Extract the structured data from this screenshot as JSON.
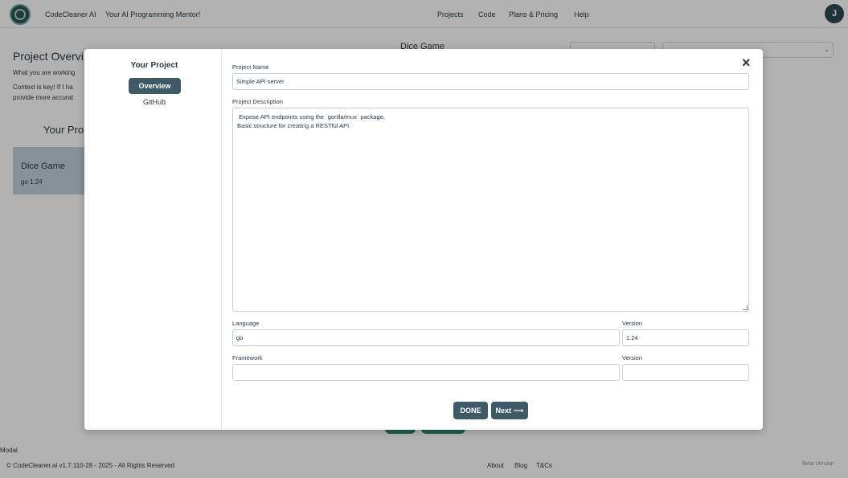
{
  "header": {
    "brand": "CodeCleaner AI",
    "tagline": "Your AI Programming Mentor!",
    "nav": [
      "Projects",
      "Code",
      "Plans & Pricing",
      "Help"
    ],
    "avatar_initial": "J"
  },
  "background": {
    "title": "Project Overvi",
    "line1": "What you are working",
    "line2": "Context is key! If I ha",
    "line3": "provide more accurat",
    "your_projects": "Your Pro",
    "project_card": {
      "name": "Dice Game",
      "meta": "go 1.24"
    },
    "dice_header": "Dice Game"
  },
  "modal": {
    "sidebar": {
      "title": "Your Project",
      "items": [
        "Overview",
        "GitHub"
      ],
      "active": "Overview"
    },
    "fields": {
      "project_name_label": "Project Name",
      "project_name_value": "Simple API server",
      "description_label": "Project Description",
      "description_lines": [
        " Expose API endpoints using the `gorilla/mux` package.",
        "Basic structure for creating a RESTful API."
      ],
      "language_label": "Language",
      "language_value": "go",
      "language_version_label": "Version",
      "language_version_value": "1.24",
      "framework_label": "Framework",
      "framework_value": "",
      "framework_version_label": "Version",
      "framework_version_value": ""
    },
    "buttons": {
      "done": "DONE",
      "next": "Next ⟶"
    },
    "close_icon": "×"
  },
  "footer": {
    "copyright": "© CodeCleaner.ai v1.7.110-28 - 2025 - All Rights Reserved",
    "links": [
      "About",
      "Blog",
      "T&Cs"
    ],
    "beta": "Beta Version",
    "modal_label": "Modal"
  },
  "colors": {
    "primary": "#3f5966",
    "card_bg": "#c4d0da",
    "accent_green": "#2c8a6b"
  }
}
